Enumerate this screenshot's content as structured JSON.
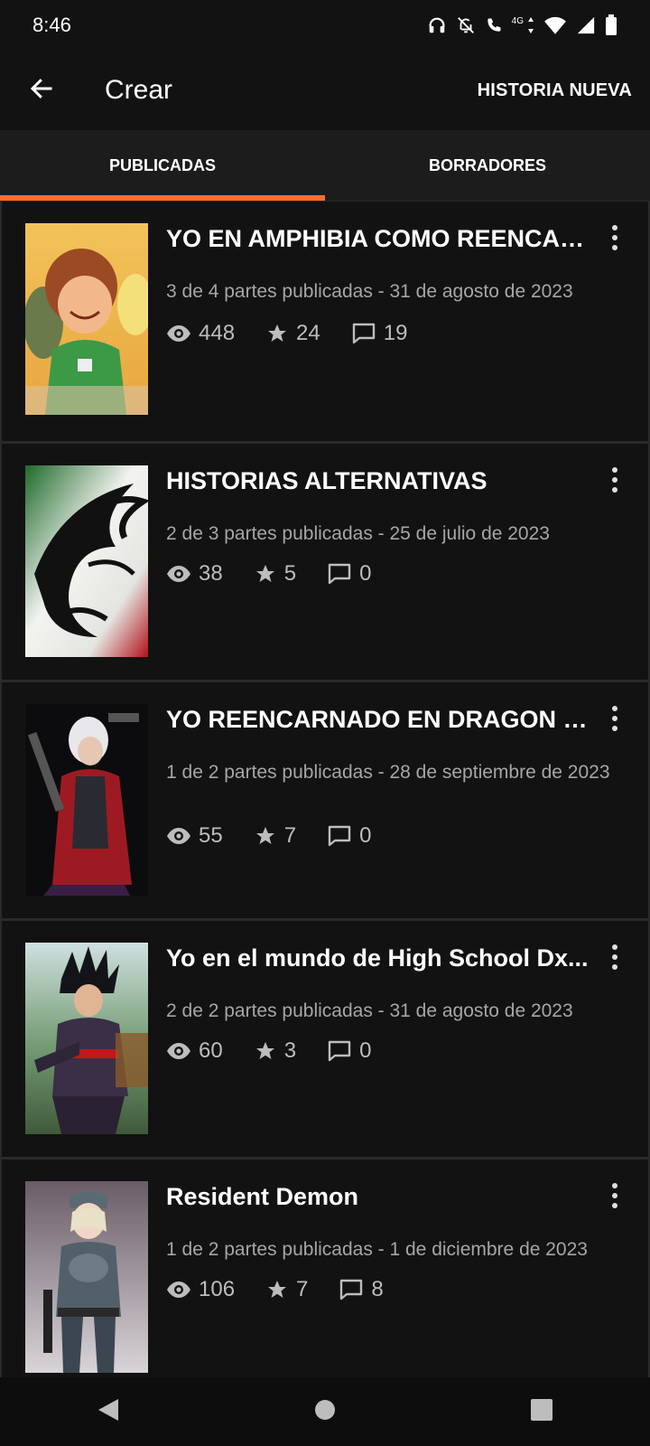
{
  "status_bar": {
    "time": "8:46",
    "network_label": "4G",
    "icons": [
      "headphones-icon",
      "bell-off-icon",
      "wifi-calling-icon",
      "wifi-icon",
      "signal-icon",
      "battery-icon"
    ]
  },
  "app_bar": {
    "title": "Crear",
    "action_label": "HISTORIA NUEVA",
    "back_icon": "arrow-left-icon"
  },
  "tabs": [
    {
      "label": "PUBLICADAS",
      "active": true
    },
    {
      "label": "BORRADORES",
      "active": false
    }
  ],
  "accent_color": "#ff6d2b",
  "stories": [
    {
      "title": "YO EN AMPHIBIA COMO REENCAR...",
      "meta": "3 de 4 partes publicadas - 31 de agosto de 2023",
      "views": "448",
      "stars": "24",
      "comments": "19"
    },
    {
      "title": "HISTORIAS ALTERNATIVAS",
      "meta": "2 de 3 partes publicadas - 25 de julio de 2023",
      "views": "38",
      "stars": "5",
      "comments": "0"
    },
    {
      "title": "YO REENCARNADO EN DRAGON B...",
      "meta": "1 de 2 partes publicadas - 28 de septiembre de 2023",
      "views": "55",
      "stars": "7",
      "comments": "0"
    },
    {
      "title": "Yo en el mundo de High School Dx...",
      "meta": "2 de 2 partes publicadas - 31 de agosto de 2023",
      "views": "60",
      "stars": "3",
      "comments": "0"
    },
    {
      "title": "Resident Demon",
      "meta": "1 de 2 partes publicadas - 1 de diciembre de 2023",
      "views": "106",
      "stars": "7",
      "comments": "8"
    }
  ],
  "nav_bar": {
    "buttons": [
      "back-triangle-icon",
      "home-circle-icon",
      "recents-square-icon"
    ]
  }
}
